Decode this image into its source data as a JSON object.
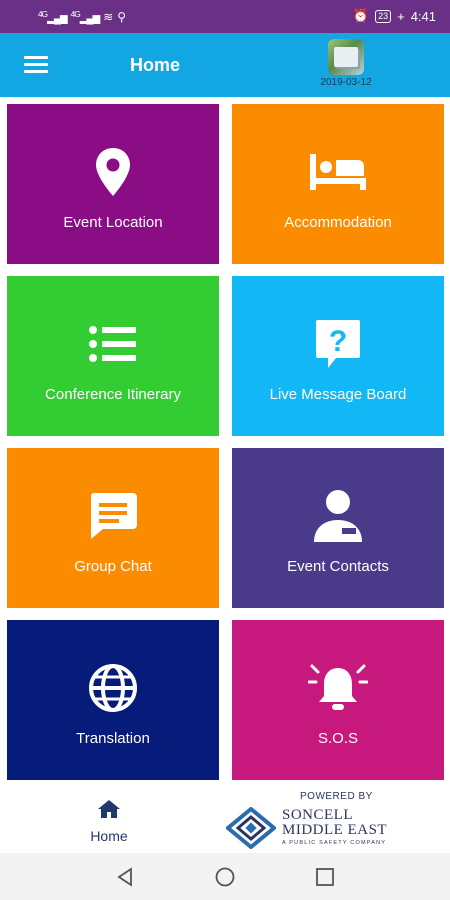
{
  "status_bar": {
    "signal1": "4G",
    "signal2": "4G",
    "battery": "23",
    "time": "4:41"
  },
  "app_bar": {
    "title": "Home",
    "logo_date": "2019-03-12"
  },
  "tiles": [
    {
      "label": "Event Location",
      "icon": "location-pin-icon",
      "color": "#8a0d86"
    },
    {
      "label": "Accommodation",
      "icon": "bed-icon",
      "color": "#fb8c00"
    },
    {
      "label": "Conference Itinerary",
      "icon": "list-icon",
      "color": "#33cc33"
    },
    {
      "label": "Live Message Board",
      "icon": "question-message-icon",
      "color": "#12b8f5"
    },
    {
      "label": "Group Chat",
      "icon": "chat-bubble-icon",
      "color": "#fb8c00"
    },
    {
      "label": "Event Contacts",
      "icon": "contact-person-icon",
      "color": "#4a3a8a"
    },
    {
      "label": "Translation",
      "icon": "globe-icon",
      "color": "#071b7a"
    },
    {
      "label": "S.O.S",
      "icon": "alarm-bell-icon",
      "color": "#c7197d"
    }
  ],
  "bottom_nav": {
    "home_label": "Home",
    "powered_by": "POWERED BY",
    "brand_line1": "SONCELL",
    "brand_line2": "MIDDLE EAST",
    "brand_tagline": "A PUBLIC SAFETY COMPANY"
  },
  "colors": {
    "status_bar": "#6a2f86",
    "app_bar": "#12a7e3",
    "nav_accent": "#22386b"
  }
}
